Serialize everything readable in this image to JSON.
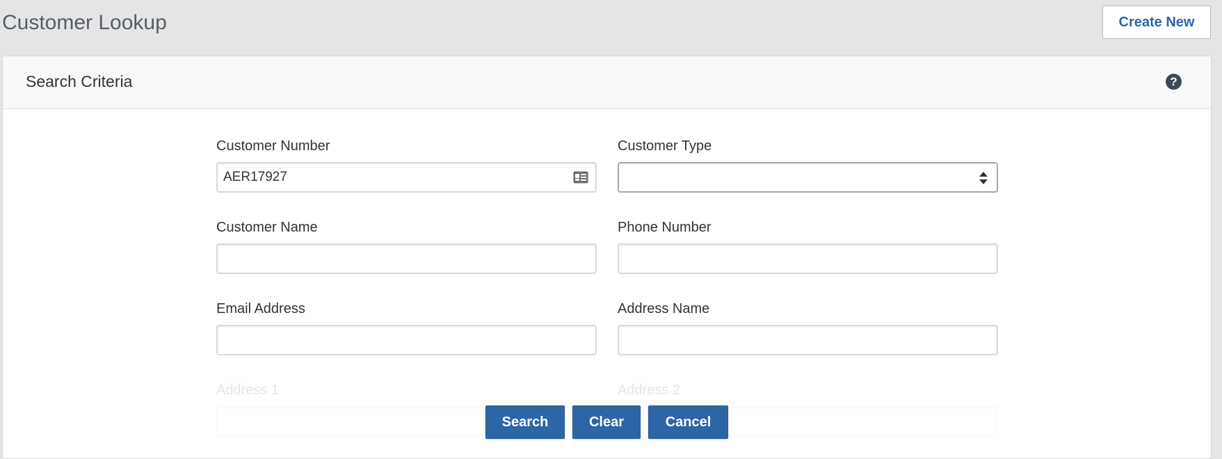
{
  "header": {
    "title": "Customer Lookup",
    "create_new_label": "Create New"
  },
  "panel": {
    "title": "Search Criteria",
    "help_icon": "?"
  },
  "fields": {
    "customer_number": {
      "label": "Customer Number",
      "value": "AER17927",
      "icon": "id-card-icon"
    },
    "customer_type": {
      "label": "Customer Type",
      "value": "",
      "icon": "select-arrows-icon"
    },
    "customer_name": {
      "label": "Customer Name",
      "value": ""
    },
    "phone_number": {
      "label": "Phone Number",
      "value": ""
    },
    "email_address": {
      "label": "Email Address",
      "value": ""
    },
    "address_name": {
      "label": "Address Name",
      "value": ""
    },
    "address_1": {
      "label": "Address 1",
      "value": ""
    },
    "address_2": {
      "label": "Address 2",
      "value": ""
    }
  },
  "actions": {
    "search_label": "Search",
    "clear_label": "Clear",
    "cancel_label": "Cancel"
  },
  "colors": {
    "accent": "#2d66a6",
    "background": "#e5e5e5",
    "help_icon": "#3b4a58"
  }
}
